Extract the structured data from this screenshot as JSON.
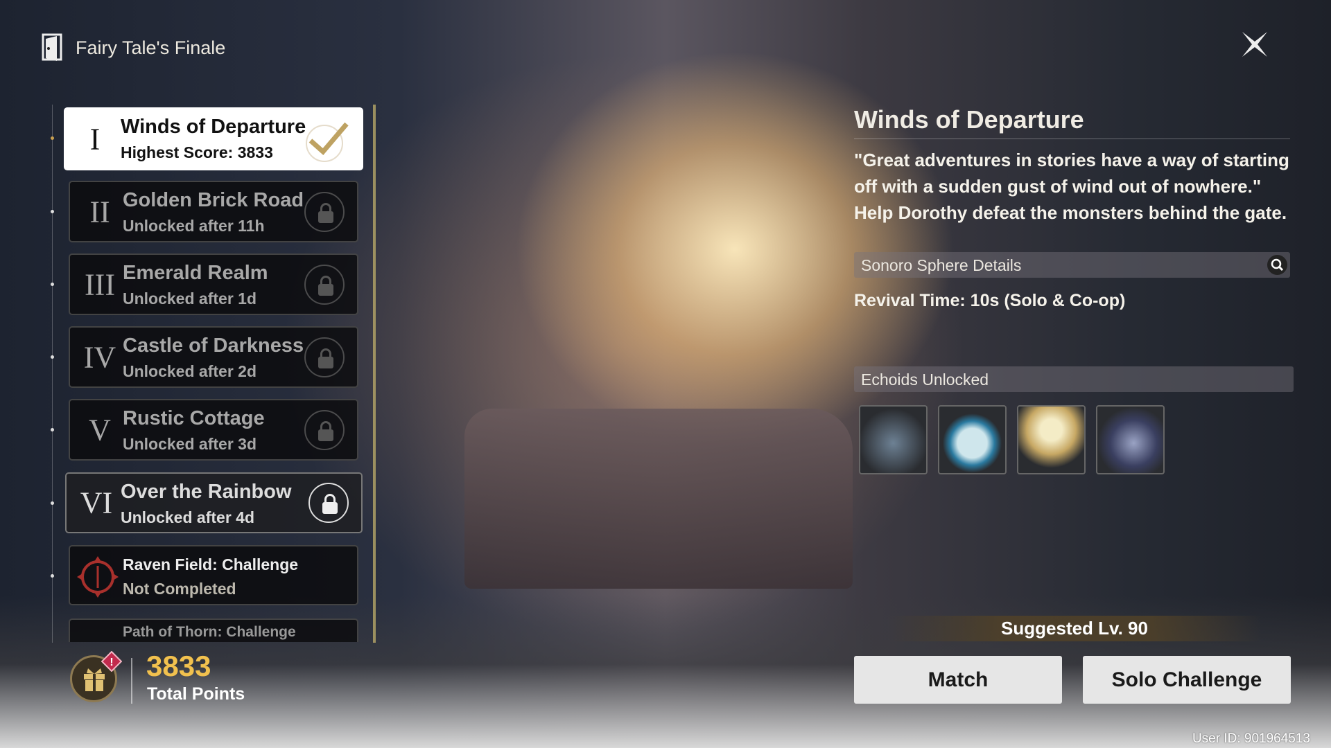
{
  "header": {
    "title": "Fairy Tale's Finale",
    "icon": "door-icon",
    "close_icon": "close-icon"
  },
  "stages": [
    {
      "numeral": "I",
      "name": "Winds of Departure",
      "status": "Highest Score: 3833",
      "state": "completed"
    },
    {
      "numeral": "II",
      "name": "Golden Brick Road",
      "status": "Unlocked after 11h",
      "state": "locked"
    },
    {
      "numeral": "III",
      "name": "Emerald Realm",
      "status": "Unlocked after 1d",
      "state": "locked"
    },
    {
      "numeral": "IV",
      "name": "Castle of Darkness",
      "status": "Unlocked after 2d",
      "state": "locked"
    },
    {
      "numeral": "V",
      "name": "Rustic Cottage",
      "status": "Unlocked after 3d",
      "state": "locked"
    },
    {
      "numeral": "VI",
      "name": "Over the Rainbow",
      "status": "Unlocked after 4d",
      "state": "locked"
    },
    {
      "name": "Raven Field: Challenge",
      "status": "Not Completed",
      "state": "challenge"
    },
    {
      "name": "Path of Thorn: Challenge",
      "state": "challenge-locked"
    }
  ],
  "points": {
    "value": "3833",
    "label": "Total Points",
    "accent": "#f2c14e"
  },
  "detail": {
    "title": "Winds of Departure",
    "quote": [
      "\"Great adventures in stories have a way of starting",
      "off with a sudden gust of wind out of nowhere.\"",
      "Help Dorothy defeat the monsters behind the gate."
    ],
    "sonoro_label": "Sonoro Sphere Details",
    "revival": "Revival Time: 10s (Solo & Co-op)",
    "echoids_label": "Echoids Unlocked",
    "echoids": [
      "echoid-1",
      "echoid-2",
      "echoid-3",
      "echoid-4"
    ],
    "suggested": "Suggested Lv. 90",
    "match": "Match",
    "solo": "Solo Challenge"
  },
  "user_id": "User ID: 901964513"
}
